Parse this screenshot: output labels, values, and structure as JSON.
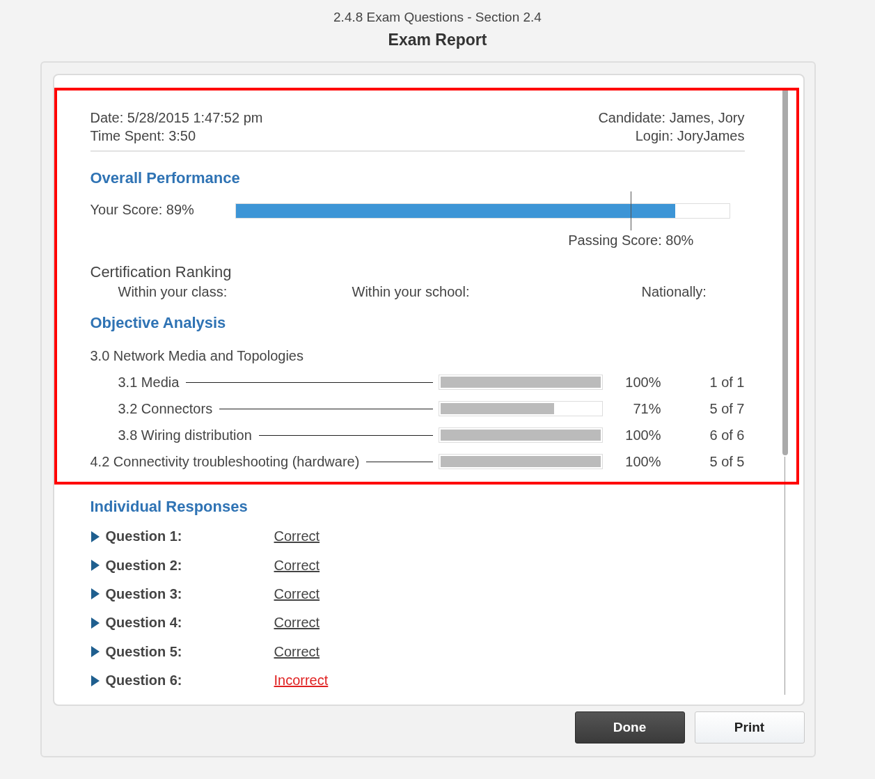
{
  "window": {
    "subtitle": "2.4.8 Exam Questions - Section 2.4",
    "title": "Exam Report"
  },
  "info": {
    "date": "Date: 5/28/2015 1:47:52 pm",
    "time_spent": "Time Spent: 3:50",
    "candidate": "Candidate: James, Jory",
    "login": "Login: JoryJames"
  },
  "overall": {
    "heading": "Overall Performance",
    "score_label": "Your Score: 89%",
    "level": 0.89,
    "passing": {
      "label": "Passing Score: 80%",
      "level": 0.8
    }
  },
  "ranking": {
    "heading": "Certification Ranking",
    "columns": [
      "Within your class:",
      "Within your school:",
      "Nationally:"
    ]
  },
  "objectives": {
    "heading": "Objective Analysis",
    "items": [
      {
        "label": "3.0 Network Media and Topologies",
        "children": [
          {
            "label": "3.1 Media",
            "level": 1.0,
            "percent": "100%",
            "count": "1 of 1"
          },
          {
            "label": "3.2 Connectors",
            "level": 0.71,
            "percent": "71%",
            "count": "5 of 7"
          },
          {
            "label": "3.8 Wiring distribution",
            "level": 1.0,
            "percent": "100%",
            "count": "6 of 6"
          }
        ]
      },
      {
        "label": "4.2 Connectivity troubleshooting (hardware)",
        "level": 1.0,
        "percent": "100%",
        "count": "5 of 5"
      }
    ]
  },
  "responses": {
    "heading": "Individual Responses",
    "items": [
      {
        "label": "Question 1:",
        "result": "Correct",
        "kind": "correct"
      },
      {
        "label": "Question 2:",
        "result": "Correct",
        "kind": "correct"
      },
      {
        "label": "Question 3:",
        "result": "Correct",
        "kind": "correct"
      },
      {
        "label": "Question 4:",
        "result": "Correct",
        "kind": "correct"
      },
      {
        "label": "Question 5:",
        "result": "Correct",
        "kind": "correct"
      },
      {
        "label": "Question 6:",
        "result": "Incorrect",
        "kind": "incorrect"
      }
    ]
  },
  "highlight": {
    "shown": true
  },
  "buttons": [
    {
      "label": "Done",
      "kind": "primary"
    },
    {
      "label": "Print",
      "kind": "secondary"
    }
  ]
}
